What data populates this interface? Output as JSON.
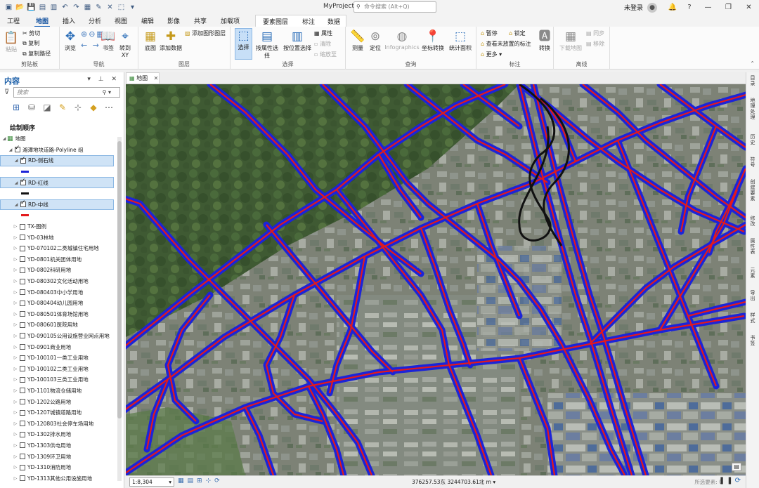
{
  "titlebar": {
    "project": "MyProject",
    "command_search_placeholder": "命令搜索 (Alt+Q)",
    "login": "未登录",
    "help": "?"
  },
  "tabs": [
    "工程",
    "地图",
    "插入",
    "分析",
    "视图",
    "编辑",
    "影像",
    "共享",
    "加载项"
  ],
  "context_tabs": {
    "group": "要素图层",
    "labeling": "标注",
    "data": "数据"
  },
  "ribbon": {
    "clipboard": {
      "paste": "粘贴",
      "cut": "剪切",
      "copy": "复制",
      "copy_path": "复制路径",
      "label": "剪贴板"
    },
    "navigate": {
      "explore": "浏览",
      "bookmarks": "书签",
      "goto_xy": "转到 XY",
      "label": "导航"
    },
    "layer": {
      "basemap": "底图",
      "add_data": "添加数据",
      "add_graphics": "添加图形图层",
      "label": "图层"
    },
    "selection": {
      "select": "选择",
      "by_attr": "按属性选择",
      "by_loc": "按位置选择",
      "attributes": "属性",
      "clear": "清除",
      "zoom_to": "缩放至",
      "label": "选择"
    },
    "inquiry": {
      "measure": "测量",
      "locate": "定位",
      "infographics": "Infographics",
      "coord_conv": "坐标转换",
      "stat_area": "统计面积",
      "label": "查询"
    },
    "labeling": {
      "pause": "暂停",
      "lock": "锁定",
      "view_unplaced": "查看未放置的标注",
      "more": "更多",
      "convert": "转换",
      "label": "标注"
    },
    "offline": {
      "download_map": "下载地图",
      "sync": "同步",
      "remove": "移除",
      "label": "离线"
    }
  },
  "contents": {
    "title": "内容",
    "search_placeholder": "搜索",
    "drawing_order": "绘制顺序",
    "map_node": "地图",
    "group_layer": "湘潭地块道路-Polyline 组",
    "sublayers": [
      {
        "name": "RD-侧石线",
        "color": "#1c24d8"
      },
      {
        "name": "RD-红线",
        "color": "#111111"
      },
      {
        "name": "RD-中线",
        "color": "#e31a1c"
      }
    ],
    "layers": [
      "TX-图例",
      "YD-03林地",
      "YD-070102二类城镇住宅用地",
      "YD-0801机关团体用地",
      "YD-0802科研用地",
      "YD-080302文化活动用地",
      "YD-080403中小学用地",
      "YD-080404幼儿园用地",
      "YD-080501体育场馆用地",
      "YD-080601医院用地",
      "YD-090105公用设施营业网点用地",
      "YD-0901商业用地",
      "YD-100101一类工业用地",
      "YD-100102二类工业用地",
      "YD-100103三类工业用地",
      "YD-1101物流仓储用地",
      "YD-1202公路用地",
      "YD-1207城镇道路用地",
      "YD-120803社会停车场用地",
      "YD-1302排水用地",
      "YD-1303供电用地",
      "YD-1309环卫用地",
      "YD-1310消防用地",
      "YD-1313其他公用设施用地"
    ]
  },
  "map": {
    "tab_label": "地图",
    "scale": "1:8,304",
    "coordinates": "376257.53东 3244703.61北 m",
    "selected_features": "所选要素: 0",
    "road_colors": {
      "edge": "#1c24d8",
      "redline": "#111111",
      "center": "#e31a1c"
    }
  },
  "right_panels": [
    "目录",
    "地理处理",
    "历史",
    "符号",
    "创建要素",
    "修改",
    "属性表",
    "元素",
    "导出",
    "样式",
    "书签"
  ]
}
